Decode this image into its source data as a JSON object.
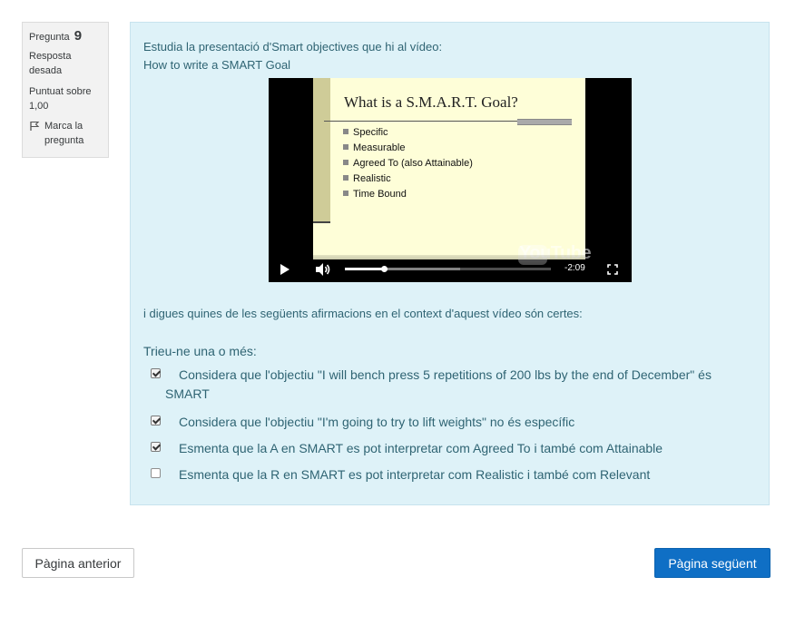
{
  "question_info": {
    "number_label": "Pregunta",
    "number": "9",
    "state": "Resposta desada",
    "grade": "Puntuat sobre 1,00",
    "flag_label": "Marca la pregunta",
    "flag_icon": "flag-icon"
  },
  "question": {
    "intro_text": "Estudia la presentació d'Smart objectives que hi al vídeo:",
    "video_link_text": "How to write a SMART Goal",
    "prompt_text": "i digues quines de les següents afirmacions en el context d'aquest vídeo són certes:",
    "instruction_text": "Trieu-ne una o més:",
    "options": [
      {
        "text": "Considera que l'objectiu \"I will bench press 5 repetitions of 200 lbs by the end of December\" és SMART",
        "checked": true
      },
      {
        "text": "Considera que l'objectiu \"I'm going to try to lift weights\" no és específic",
        "checked": true
      },
      {
        "text": "Esmenta que la A en SMART es pot interpretar com Agreed To i també com Attainable",
        "checked": true
      },
      {
        "text": "Esmenta que la R en SMART es pot interpretar com Realistic i també com Relevant",
        "checked": false
      }
    ]
  },
  "video": {
    "slide_title": "What is a S.M.A.R.T. Goal?",
    "slide_items": [
      "Specific",
      "Measurable",
      "Agreed To (also Attainable)",
      "Realistic",
      "Time Bound"
    ],
    "watermark": "YouTube",
    "time_remaining": "-2:09",
    "progress_fraction": 0.19,
    "buffered_fraction": 0.56,
    "icons": {
      "play": "play-icon",
      "volume": "volume-icon",
      "fullscreen": "fullscreen-icon"
    }
  },
  "navigation": {
    "prev_label": "Pàgina anterior",
    "next_label": "Pàgina següent"
  },
  "colors": {
    "content_bg": "#def2f8",
    "text_accent": "#2f6473",
    "primary_button": "#0f6fc5"
  }
}
